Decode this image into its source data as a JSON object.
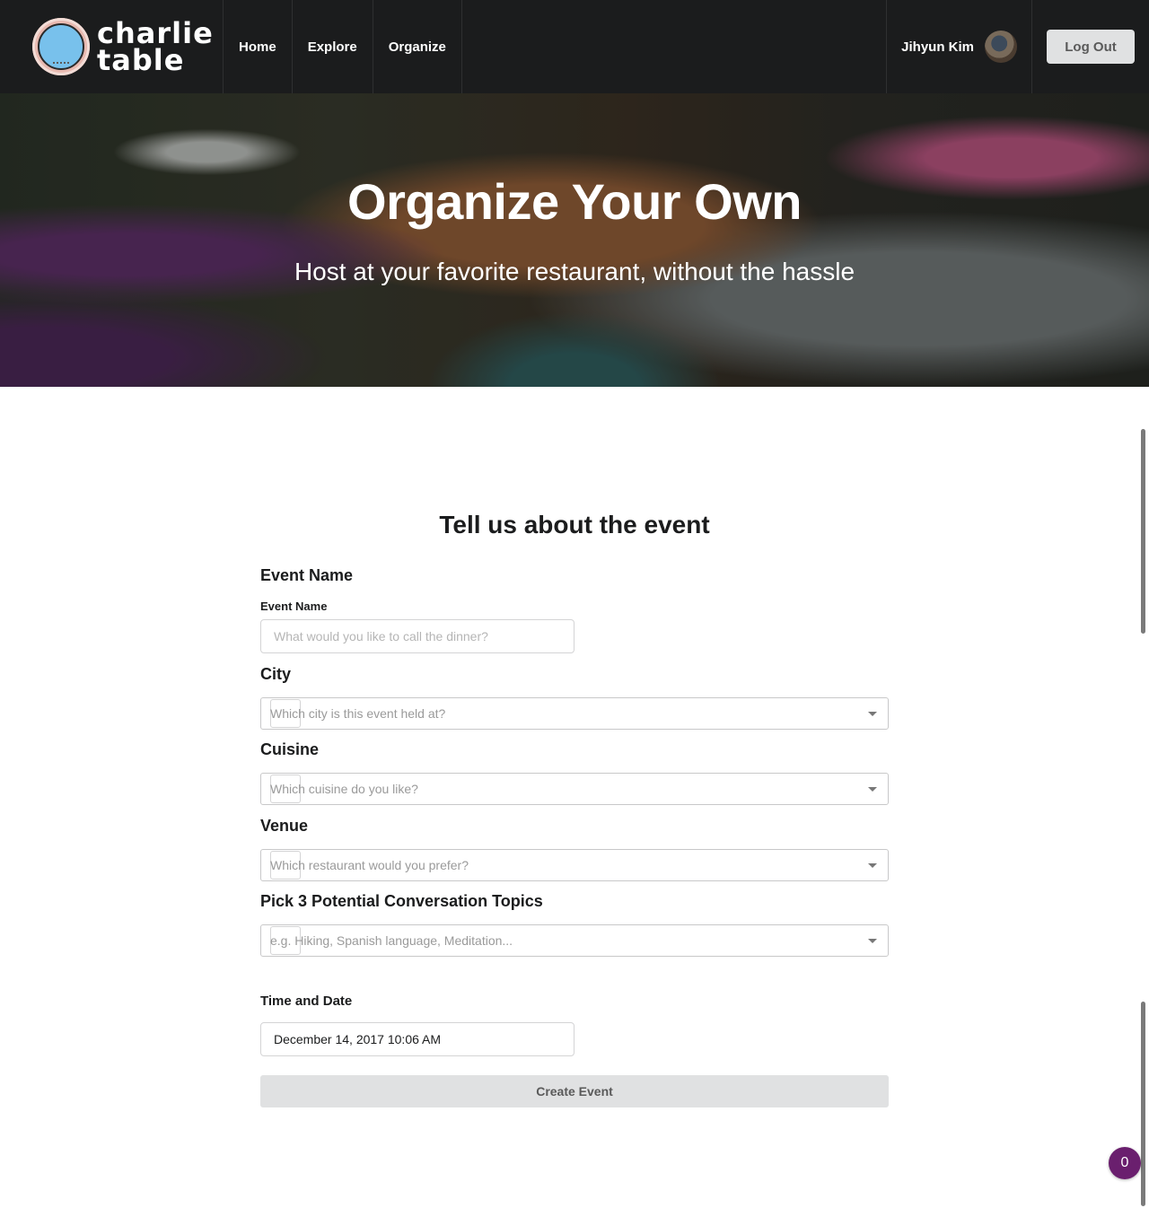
{
  "brand": {
    "line1": "charlie",
    "line2": "table"
  },
  "nav": {
    "items": [
      "Home",
      "Explore",
      "Organize"
    ]
  },
  "user": {
    "name": "Jihyun Kim",
    "logout_label": "Log Out"
  },
  "hero": {
    "title": "Organize Your Own",
    "subtitle": "Host at your favorite restaurant, without the hassle"
  },
  "form": {
    "heading": "Tell us about the event",
    "event_name": {
      "section": "Event Name",
      "label": "Event Name",
      "placeholder": "What would you like to call the dinner?"
    },
    "city": {
      "section": "City",
      "placeholder": "Which city is this event held at?"
    },
    "cuisine": {
      "section": "Cuisine",
      "placeholder": "Which cuisine do you like?"
    },
    "venue": {
      "section": "Venue",
      "placeholder": "Which restaurant would you prefer?"
    },
    "topics": {
      "section": "Pick 3 Potential Conversation Topics",
      "placeholder": "e.g. Hiking, Spanish language, Meditation..."
    },
    "datetime": {
      "label": "Time and Date",
      "value": "December 14, 2017 10:06 AM"
    },
    "submit_label": "Create Event"
  },
  "chat_badge": {
    "count": "0"
  },
  "colors": {
    "navbar": "#1b1c1d",
    "button_gray": "#e0e1e2",
    "badge": "#6a1f6e",
    "logo_blue": "#78c1ec"
  }
}
